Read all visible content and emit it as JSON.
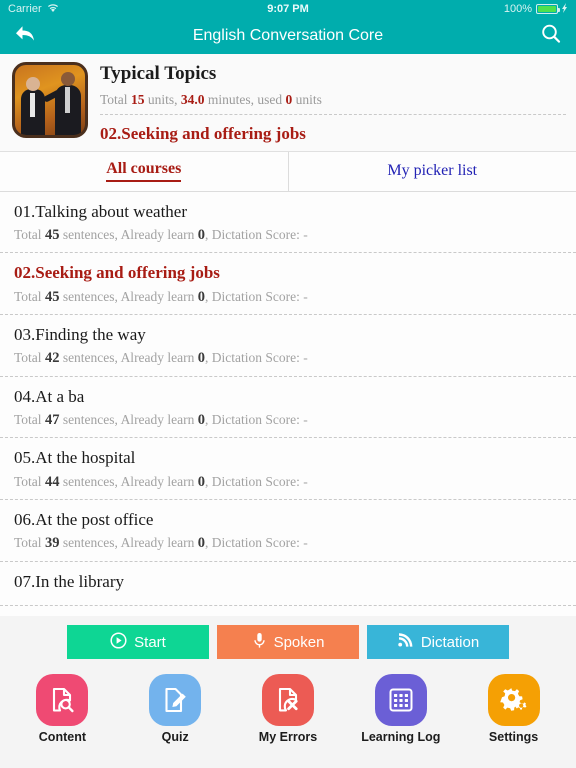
{
  "statusbar": {
    "carrier": "Carrier",
    "wifi_icon": "wifi-icon",
    "time": "9:07 PM",
    "battery_percent": "100%",
    "battery_icon": "battery-icon",
    "charging_icon": "charging-bolt-icon"
  },
  "navbar": {
    "back_icon": "back-arrow-icon",
    "title": "English Conversation Core",
    "search_icon": "search-icon"
  },
  "topic": {
    "thumbnail_icon": "topic-thumbnail-image",
    "title": "Typical Topics",
    "stats": {
      "total_label": "Total",
      "units_count": "15",
      "units_word": "units,",
      "minutes": "34.0",
      "minutes_word": "minutes,",
      "used_label": "used",
      "used_count": "0",
      "used_word": "units"
    },
    "subtitle": "02.Seeking and offering jobs"
  },
  "tabs": [
    {
      "label": "All courses",
      "active": true
    },
    {
      "label": "My picker list",
      "active": false
    }
  ],
  "list": {
    "meta_total": "Total",
    "meta_sentences": "sentences,",
    "meta_already": "Already learn",
    "meta_dictation": ", Dictation Score:",
    "items": [
      {
        "title": "01.Talking about weather",
        "total": "45",
        "learned": "0",
        "score": "-",
        "selected": false
      },
      {
        "title": "02.Seeking and offering jobs",
        "total": "45",
        "learned": "0",
        "score": "-",
        "selected": true
      },
      {
        "title": "03.Finding the way",
        "total": "42",
        "learned": "0",
        "score": "-",
        "selected": false
      },
      {
        "title": "04.At a ba",
        "total": "47",
        "learned": "0",
        "score": "-",
        "selected": false
      },
      {
        "title": "05.At the hospital",
        "total": "44",
        "learned": "0",
        "score": "-",
        "selected": false
      },
      {
        "title": "06.At the post office",
        "total": "39",
        "learned": "0",
        "score": "-",
        "selected": false
      },
      {
        "title": "07.In the library",
        "total": "",
        "learned": "",
        "score": "",
        "selected": false
      }
    ]
  },
  "actions": [
    {
      "label": "Start",
      "icon": "play-circle-icon",
      "color": "#0ed694"
    },
    {
      "label": "Spoken",
      "icon": "microphone-icon",
      "color": "#f5804f"
    },
    {
      "label": "Dictation",
      "icon": "signal-waves-icon",
      "color": "#38b5d8"
    }
  ],
  "tabbar": [
    {
      "label": "Content",
      "icon": "document-search-icon",
      "color": "#ef4a73"
    },
    {
      "label": "Quiz",
      "icon": "document-pencil-icon",
      "color": "#73b3ed"
    },
    {
      "label": "My Errors",
      "icon": "document-x-icon",
      "color": "#ec5b54"
    },
    {
      "label": "Learning Log",
      "icon": "calendar-grid-icon",
      "color": "#6b5fd6"
    },
    {
      "label": "Settings",
      "icon": "gears-icon",
      "color": "#f5a004"
    }
  ],
  "colors": {
    "accent_teal": "#00adad",
    "highlight_red": "#a81c14",
    "link_blue": "#2222b4"
  }
}
